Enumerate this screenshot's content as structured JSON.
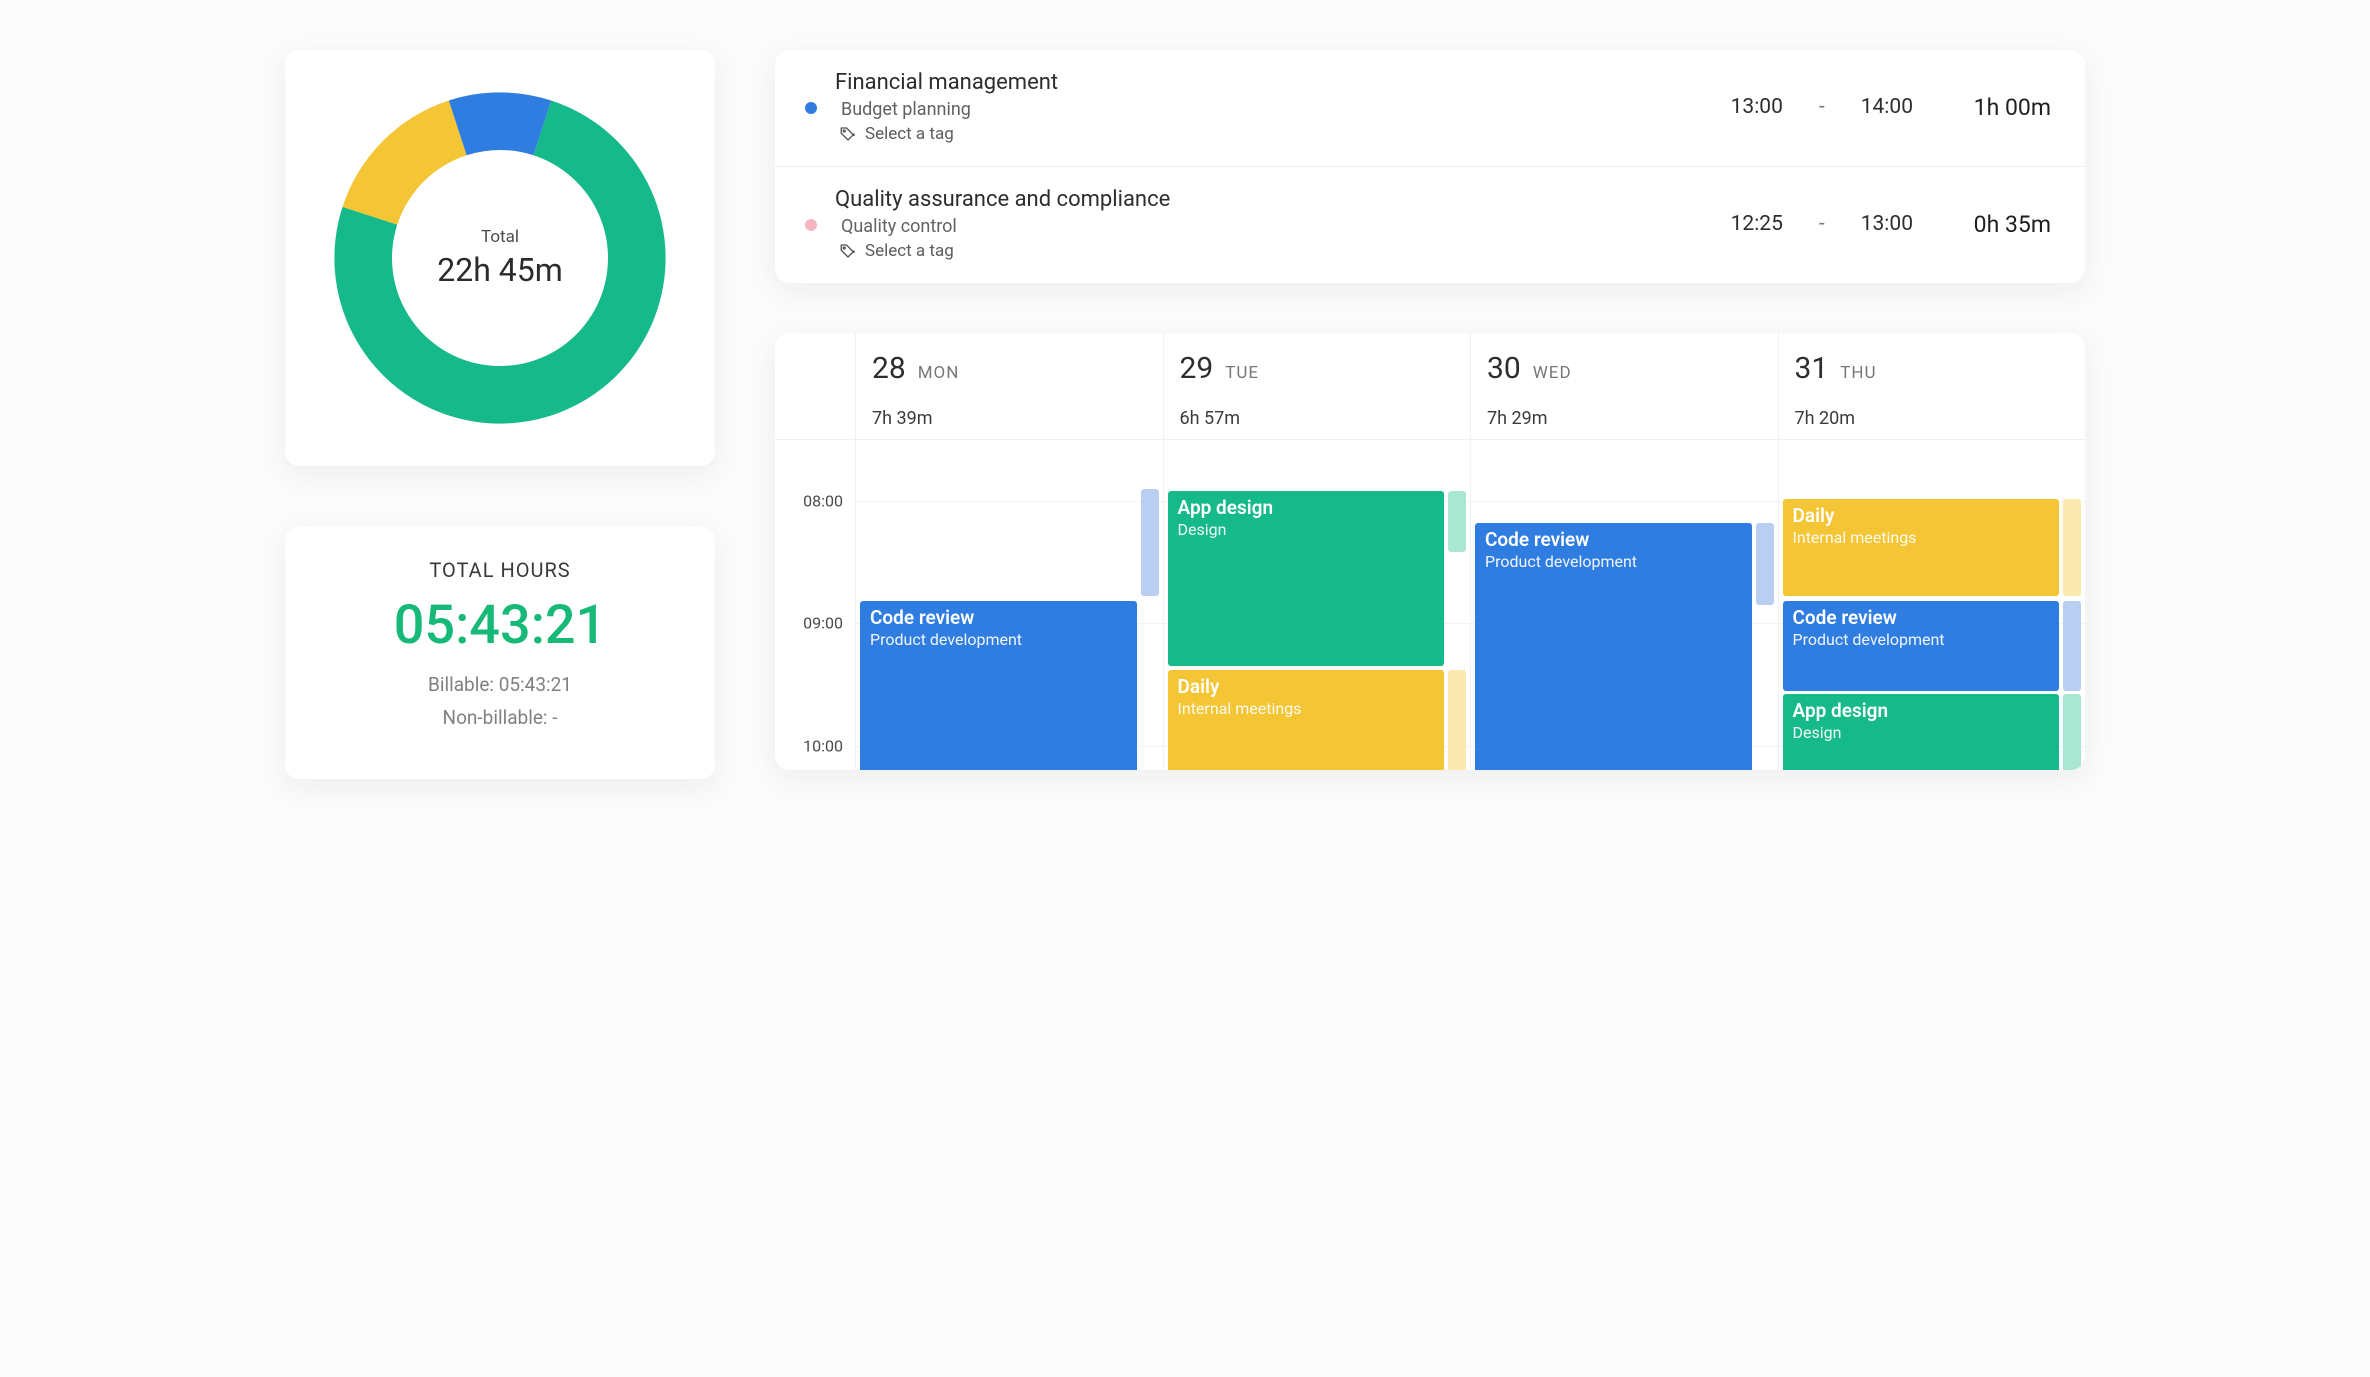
{
  "colors": {
    "green": "#16b98a",
    "blue": "#2f7de1",
    "yellow": "#f4c534",
    "pink": "#f4b7c2",
    "paleBlue": "#b9cef0",
    "paleYellow": "#fbe9b0",
    "paleGreen": "#a9e7d3"
  },
  "donut": {
    "label": "Total",
    "value": "22h 45m"
  },
  "chart_data": {
    "type": "pie",
    "title": "Total",
    "total_label": "22h 45m",
    "series": [
      {
        "name": "green",
        "value": 75,
        "color": "#16b98a"
      },
      {
        "name": "yellow",
        "value": 15,
        "color": "#f4c534"
      },
      {
        "name": "blue",
        "value": 10,
        "color": "#2f7de1"
      }
    ]
  },
  "totalHours": {
    "title": "TOTAL HOURS",
    "value": "05:43:21",
    "billable_label": "Billable: 05:43:21",
    "nonbillable_label": "Non-billable: -"
  },
  "entries": [
    {
      "dotColor": "#2f7de1",
      "title": "Financial management",
      "subtitle": "Budget planning",
      "tag_prompt": "Select a tag",
      "start": "13:00",
      "dash": "-",
      "end": "14:00",
      "duration": "1h 00m"
    },
    {
      "dotColor": "#f4b7c2",
      "title": "Quality assurance and compliance",
      "subtitle": "Quality control",
      "tag_prompt": "Select a tag",
      "start": "12:25",
      "dash": "-",
      "end": "13:00",
      "duration": "0h 35m"
    }
  ],
  "calendar": {
    "time_labels": [
      "08:00",
      "09:00",
      "10:00"
    ],
    "time_start": 7.5,
    "time_end": 10.2,
    "days": [
      {
        "num": "28",
        "dow": "MON",
        "total": "7h 39m"
      },
      {
        "num": "29",
        "dow": "TUE",
        "total": "6h 57m"
      },
      {
        "num": "30",
        "dow": "WED",
        "total": "7h 29m"
      },
      {
        "num": "31",
        "dow": "THU",
        "total": "7h 20m"
      }
    ],
    "events": [
      {
        "day": 0,
        "title": "Code review",
        "sub": "Product development",
        "color": "#2f7de1",
        "start": 8.82,
        "end": 10.3,
        "mini_color": "#b9cef0",
        "mini_start": 7.9,
        "mini_end": 8.78
      },
      {
        "day": 1,
        "title": "App design",
        "sub": "Design",
        "color": "#16b98a",
        "start": 7.92,
        "end": 9.35,
        "mini_color": "#a9e7d3",
        "mini_start": 7.92,
        "mini_end": 8.42
      },
      {
        "day": 1,
        "title": "Daily",
        "sub": "Internal meetings",
        "color": "#f4c534",
        "start": 9.38,
        "end": 10.3,
        "mini_color": "#fbe9b0",
        "mini_start": 9.38,
        "mini_end": 10.3
      },
      {
        "day": 2,
        "title": "Code review",
        "sub": "Product development",
        "color": "#2f7de1",
        "start": 8.18,
        "end": 10.3,
        "mini_color": "#b9cef0",
        "mini_start": 8.18,
        "mini_end": 8.85
      },
      {
        "day": 3,
        "title": "Daily",
        "sub": "Internal meetings",
        "color": "#f4c534",
        "start": 7.98,
        "end": 8.78,
        "mini_color": "#fbe9b0",
        "mini_start": 7.98,
        "mini_end": 8.78
      },
      {
        "day": 3,
        "title": "Code review",
        "sub": "Product development",
        "color": "#2f7de1",
        "start": 8.82,
        "end": 9.55,
        "mini_color": "#b9cef0",
        "mini_start": 8.82,
        "mini_end": 9.55
      },
      {
        "day": 3,
        "title": "App design",
        "sub": "Design",
        "color": "#16b98a",
        "start": 9.58,
        "end": 10.3,
        "mini_color": "#a9e7d3",
        "mini_start": 9.58,
        "mini_end": 10.3
      }
    ]
  }
}
